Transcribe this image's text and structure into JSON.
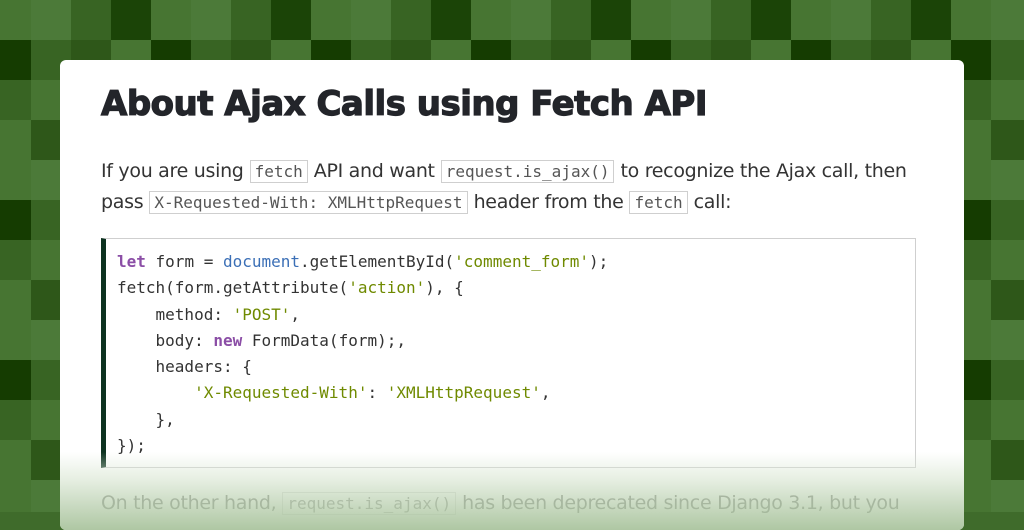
{
  "page": {
    "title": "About Ajax Calls using Fetch API",
    "theme": {
      "background_tiles": [
        "#477532",
        "#4c7a39",
        "#386423",
        "#1b4407",
        "#153c01",
        "#2e5719"
      ],
      "code_border_accent": "#0d3220",
      "keyword_color": "#8b4ea6",
      "builtin_color": "#3b6fb6",
      "string_color": "#6f8a00"
    }
  },
  "intro": {
    "t1": "If you are using",
    "c1": "fetch",
    "t2": "API and want",
    "c2": "request.is_ajax()",
    "t3": "to recognize the Ajax call, then pass",
    "c3": "X-Requested-With: XMLHttpRequest",
    "t4": "header from the",
    "c4": "fetch",
    "t5": "call:"
  },
  "code": {
    "lines": [
      [
        {
          "k": "kw",
          "t": "let"
        },
        {
          "k": "",
          "t": " form = "
        },
        {
          "k": "bi",
          "t": "document"
        },
        {
          "k": "",
          "t": ".getElementById("
        },
        {
          "k": "str",
          "t": "'comment_form'"
        },
        {
          "k": "",
          "t": ");"
        }
      ],
      [
        {
          "k": "",
          "t": "fetch(form.getAttribute("
        },
        {
          "k": "str",
          "t": "'action'"
        },
        {
          "k": "",
          "t": "), {"
        }
      ],
      [
        {
          "k": "",
          "t": "    method: "
        },
        {
          "k": "str",
          "t": "'POST'"
        },
        {
          "k": "",
          "t": ","
        }
      ],
      [
        {
          "k": "",
          "t": "    body: "
        },
        {
          "k": "kw",
          "t": "new"
        },
        {
          "k": "",
          "t": " FormData(form);,"
        }
      ],
      [
        {
          "k": "",
          "t": "    headers: {"
        }
      ],
      [
        {
          "k": "",
          "t": "        "
        },
        {
          "k": "str",
          "t": "'X-Requested-With'"
        },
        {
          "k": "",
          "t": ": "
        },
        {
          "k": "str",
          "t": "'XMLHttpRequest'"
        },
        {
          "k": "",
          "t": ","
        }
      ],
      [
        {
          "k": "",
          "t": "    },"
        }
      ],
      [
        {
          "k": "",
          "t": "});"
        }
      ]
    ]
  },
  "outro": {
    "t1": "On the other hand,",
    "c1": "request.is_ajax()",
    "t2": "has been deprecated since Django 3.1, but you"
  }
}
